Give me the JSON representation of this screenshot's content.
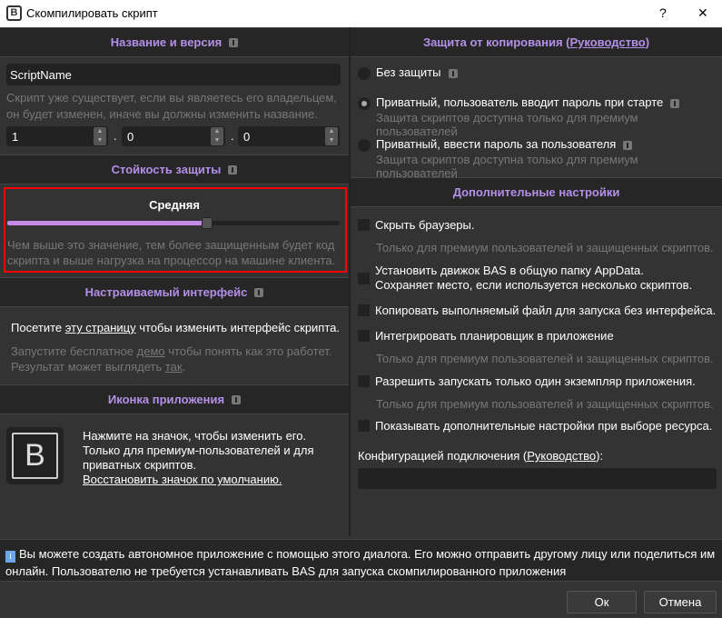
{
  "window": {
    "title": "Скомпилировать скрипт",
    "help": "?",
    "close": "✕"
  },
  "name_version": {
    "header": "Название и версия",
    "name_value": "ScriptName",
    "hint": "Скрипт уже существует, если вы являетесь его владельцем, он будет изменен, иначе вы должны изменить название.",
    "version": [
      "1",
      "0",
      "0"
    ],
    "sep": "."
  },
  "strength": {
    "header": "Стойкость защиты",
    "level": "Средняя",
    "slider_percent": 60,
    "hint": "Чем выше это значение, тем более защищенным будет код скрипта и выше нагрузка на процессор на машине клиента."
  },
  "interface": {
    "header": "Настраиваемый интерфейс",
    "visit_pre": "Посетите ",
    "visit_link": "эту страницу",
    "visit_post": " чтобы изменить интерфейс скрипта.",
    "demo_pre": "Запустите бесплатное ",
    "demo_link": "демо",
    "demo_post": " чтобы понять как это работет.",
    "result_pre": "Результат может выглядеть ",
    "result_link": "так",
    "result_post": "."
  },
  "icon": {
    "header": "Иконка приложения",
    "line1": "Нажмите на значок, чтобы изменить его.",
    "line2": "Только для премиум-пользователей и для приватных скриптов.",
    "restore": "Восстановить значок по умолчанию."
  },
  "protection": {
    "header_pre": "Защита от копирования (",
    "header_link": "Руководство",
    "header_post": ")",
    "options": [
      {
        "label": "Без защиты",
        "note": "",
        "selected": false
      },
      {
        "label": "Приватный, пользователь вводит пароль при старте",
        "note": "Защита скриптов доступна только для премиум пользователей",
        "selected": true
      },
      {
        "label": "Приватный, ввести пароль за пользователя",
        "note": "Защита скриптов доступна только для премиум пользователей",
        "selected": false
      }
    ]
  },
  "extra": {
    "header": "Дополнительные настройки",
    "items": [
      {
        "label": "Скрыть браузеры.",
        "note": "Только для премиум пользователей и защищенных скриптов.",
        "checked": false
      },
      {
        "label": "Установить движок BAS в общую папку AppData.",
        "label2": "Сохраняет место, если используется несколько скриптов.",
        "checked": false
      },
      {
        "label": "Копировать выполняемый файл для запуска без интерфейса.",
        "checked": false
      },
      {
        "label": "Интегрировать планировщик в приложение",
        "note": "Только для премиум пользователей и защищенных скриптов.",
        "checked": false
      },
      {
        "label": "Разрешить запускать только один экземпляр приложения.",
        "note": "Только для премиум пользователей и защищенных скриптов.",
        "checked": false
      },
      {
        "label": "Показывать дополнительные настройки при выборе ресурса.",
        "checked": false
      }
    ],
    "config_pre": "Конфигурацией подключения (",
    "config_link": "Руководство",
    "config_post": "):",
    "config_value": ""
  },
  "footer": {
    "info": "Вы можете создать автономное приложение с помощью этого диалога. Его можно отправить другому лицу или поделиться им онлайн. Пользователю не требуется устанавливать BAS для запуска скомпилированного приложения",
    "ok": "Ок",
    "cancel": "Отмена"
  }
}
